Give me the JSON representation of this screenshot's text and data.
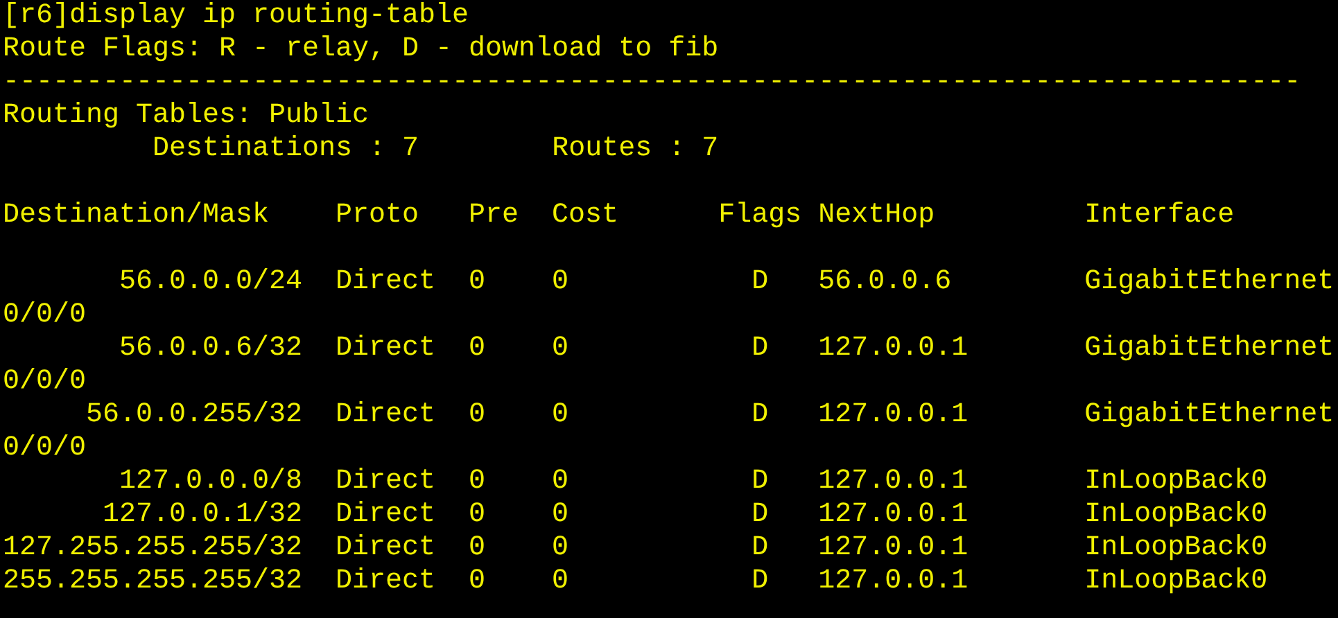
{
  "command": "[r6]display ip routing-table",
  "flags_legend": "Route Flags: R - relay, D - download to fib",
  "separator": "------------------------------------------------------------------------------",
  "table_title": "Routing Tables: Public",
  "destinations": "Destinations : 7",
  "routes": "Routes : 7",
  "columns": [
    "Destination/Mask",
    "Proto",
    "Pre",
    "Cost",
    "Flags",
    "NextHop",
    "Interface"
  ],
  "rows": [
    {
      "destination": "56.0.0.0/24",
      "proto": "Direct",
      "pre": "0",
      "cost": "0",
      "flags": "D",
      "nexthop": "56.0.0.6",
      "interface": "GigabitEthernet",
      "interface_cont": "0/0/0"
    },
    {
      "destination": "56.0.0.6/32",
      "proto": "Direct",
      "pre": "0",
      "cost": "0",
      "flags": "D",
      "nexthop": "127.0.0.1",
      "interface": "GigabitEthernet",
      "interface_cont": "0/0/0"
    },
    {
      "destination": "56.0.0.255/32",
      "proto": "Direct",
      "pre": "0",
      "cost": "0",
      "flags": "D",
      "nexthop": "127.0.0.1",
      "interface": "GigabitEthernet",
      "interface_cont": "0/0/0"
    },
    {
      "destination": "127.0.0.0/8",
      "proto": "Direct",
      "pre": "0",
      "cost": "0",
      "flags": "D",
      "nexthop": "127.0.0.1",
      "interface": "InLoopBack0"
    },
    {
      "destination": "127.0.0.1/32",
      "proto": "Direct",
      "pre": "0",
      "cost": "0",
      "flags": "D",
      "nexthop": "127.0.0.1",
      "interface": "InLoopBack0"
    },
    {
      "destination": "127.255.255.255/32",
      "proto": "Direct",
      "pre": "0",
      "cost": "0",
      "flags": "D",
      "nexthop": "127.0.0.1",
      "interface": "InLoopBack0"
    },
    {
      "destination": "255.255.255.255/32",
      "proto": "Direct",
      "pre": "0",
      "cost": "0",
      "flags": "D",
      "nexthop": "127.0.0.1",
      "interface": "InLoopBack0"
    }
  ]
}
